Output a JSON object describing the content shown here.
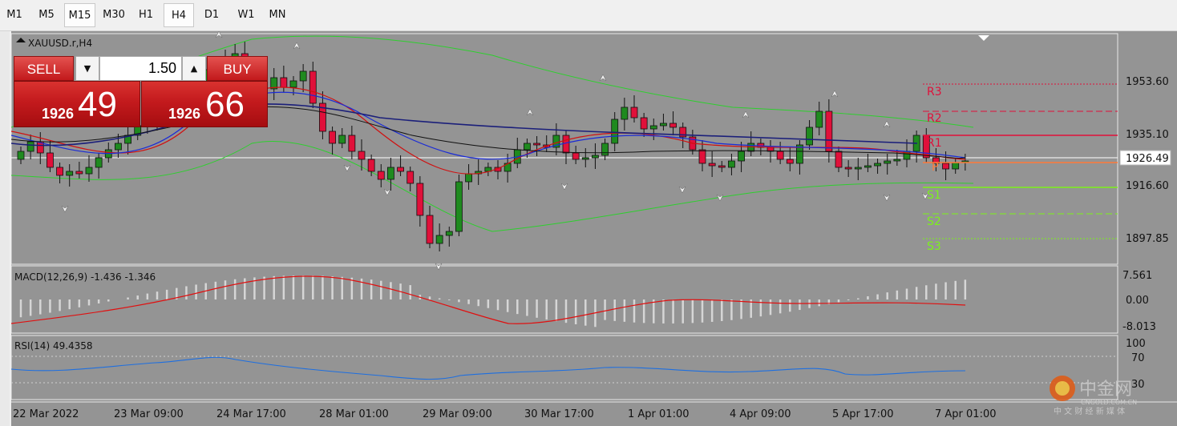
{
  "timeframes": [
    {
      "label": "M1",
      "active": false
    },
    {
      "label": "M5",
      "active": false
    },
    {
      "label": "M15",
      "active": true
    },
    {
      "label": "M30",
      "active": false
    },
    {
      "label": "H1",
      "active": false
    },
    {
      "label": "H4",
      "active": true
    },
    {
      "label": "D1",
      "active": false
    },
    {
      "label": "W1",
      "active": false
    },
    {
      "label": "MN",
      "active": false
    }
  ],
  "chart": {
    "symbol_caption": "XAUUSD.r,H4",
    "price_axis": [
      "1953.60",
      "1935.10",
      "1916.60",
      "1897.85"
    ],
    "current_price_tag": "1926.49",
    "time_axis": [
      "22 Mar 2022",
      "23 Mar 09:00",
      "24 Mar 17:00",
      "28 Mar 01:00",
      "29 Mar 09:00",
      "30 Mar 17:00",
      "1 Apr 01:00",
      "4 Apr 09:00",
      "5 Apr 17:00",
      "7 Apr 01:00"
    ],
    "pivot_labels": {
      "r3": "R3",
      "r2": "R2",
      "r1": "R1",
      "pp": "P",
      "s1": "S1",
      "s2": "S2",
      "s3": "S3"
    },
    "colors": {
      "plot_bg": "#949494",
      "bull": "#1f8a1f",
      "bear": "#e0103a",
      "ma_red": "#d01010",
      "ma_blue": "#1a2bd6",
      "ma_navy": "#1b1f7a",
      "bands": "#2ecf2e",
      "resistance": "#e0103a",
      "support": "#7cf21a",
      "macd_signal": "#e01010",
      "rsi_line": "#1e6fe0"
    }
  },
  "trade_panel": {
    "sell_label": "SELL",
    "buy_label": "BUY",
    "lot_value": "1.50",
    "sell_price_small": "1926",
    "sell_price_big": "49",
    "buy_price_small": "1926",
    "buy_price_big": "66"
  },
  "macd": {
    "caption": "MACD(12,26,9) -1.436 -1.346",
    "axis": [
      "7.561",
      "0.00",
      "-8.013"
    ]
  },
  "rsi": {
    "caption": "RSI(14) 49.4358",
    "axis": [
      "100",
      "70",
      "30"
    ]
  },
  "watermark": {
    "brand": "中金网",
    "url": "CNGOLD.COM.CN",
    "tagline": "中 文 财 经 新 媒 体"
  }
}
